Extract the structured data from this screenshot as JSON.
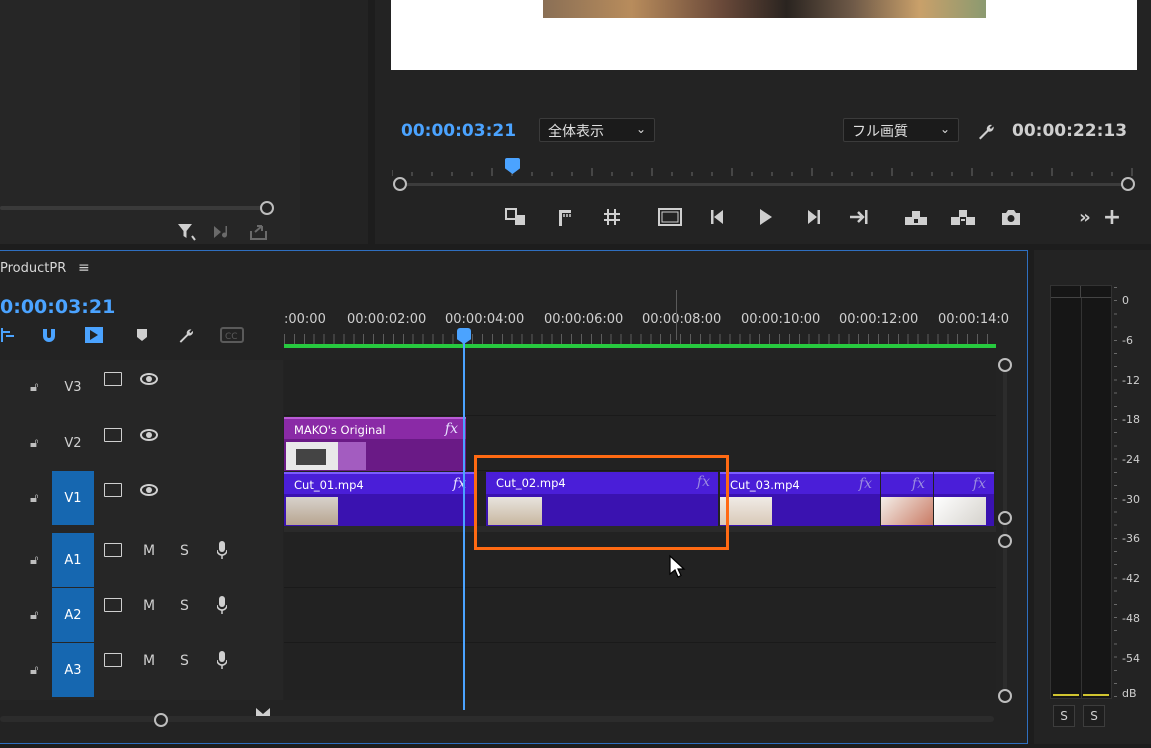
{
  "monitor": {
    "current_timecode": "00:00:03:21",
    "zoom_select": "全体表示",
    "quality_select": "フル画質",
    "duration_timecode": "00:00:22:13"
  },
  "timeline": {
    "sequence_name": "ProductPR",
    "timecode": "0:00:03:21",
    "ruler_labels": [
      ":00:00",
      "00:00:02:00",
      "00:00:04:00",
      "00:00:06:00",
      "00:00:08:00",
      "00:00:10:00",
      "00:00:12:00",
      "00:00:14:0"
    ],
    "tracks": {
      "v3": "V3",
      "v2": "V2",
      "v1": "V1",
      "a1": "A1",
      "a2": "A2",
      "a3": "A3"
    },
    "mute": "M",
    "solo": "S",
    "clips": {
      "v2_clip": "MAKO's Original",
      "v1_clip1": "Cut_01.mp4",
      "v1_clip2": "Cut_02.mp4",
      "v1_clip3": "Cut_03.mp4",
      "fx": "fx"
    }
  },
  "meter": {
    "scale": [
      "0",
      "-6",
      "-12",
      "-18",
      "-24",
      "-30",
      "-36",
      "-42",
      "-48",
      "-54",
      "dB"
    ],
    "solo_left": "S",
    "solo_right": "S"
  },
  "colors": {
    "accent_blue": "#4ba3ff",
    "clip_purple": "#4a1ed8",
    "graphic_clip": "#8a2aa6",
    "highlight_orange": "#ff6a13",
    "work_area_green": "#27c93f"
  }
}
